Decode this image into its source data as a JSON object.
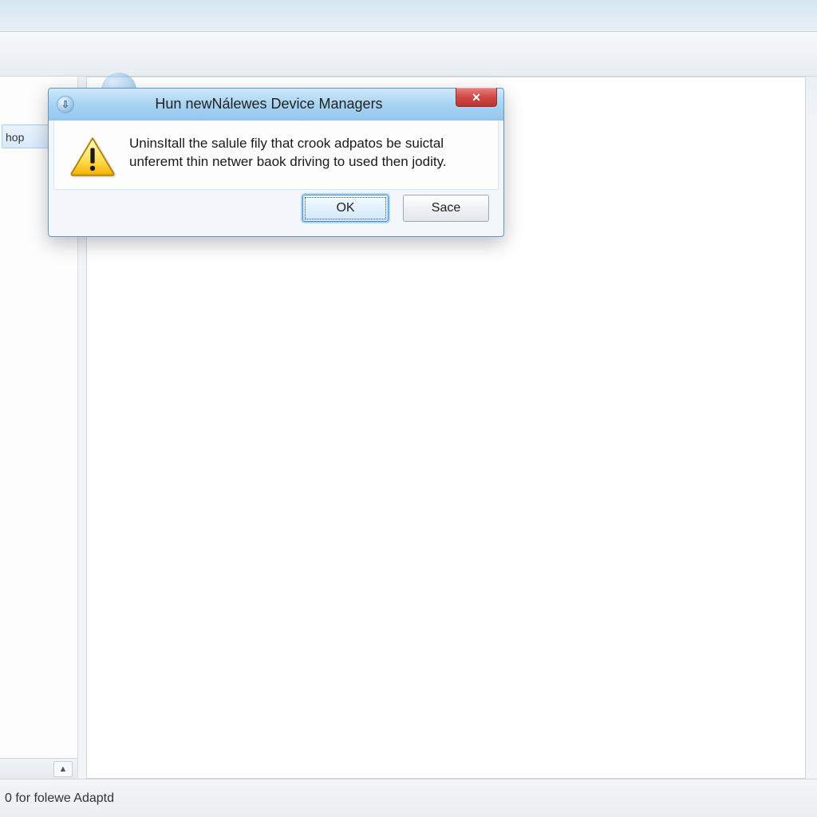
{
  "window": {
    "title": ""
  },
  "sidebar": {
    "items": [
      {
        "label": ""
      },
      {
        "label": ""
      },
      {
        "label": "hop"
      }
    ]
  },
  "statusbar": {
    "text": "0 for folewe Adaptd"
  },
  "dialog": {
    "title": "Hun newNálewes Device Managers",
    "message": "UninsItall the salule fily that crook adpatos be suictal unferemt thin netwer baok driving to used then jodity.",
    "ok_label": "OK",
    "secondary_label": "Sace"
  }
}
